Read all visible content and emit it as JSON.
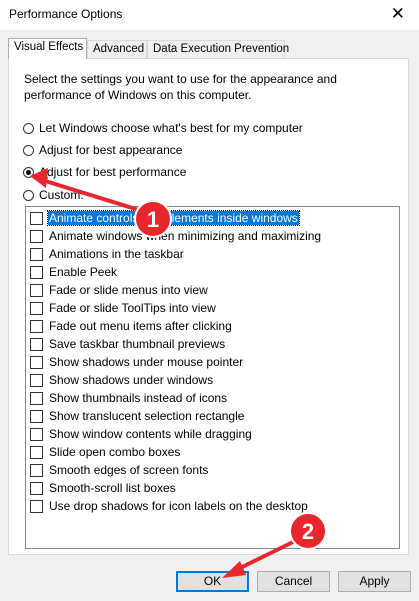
{
  "window": {
    "title": "Performance Options",
    "close_glyph": "✕"
  },
  "tabs": [
    {
      "label": "Visual Effects",
      "active": true
    },
    {
      "label": "Advanced",
      "active": false
    },
    {
      "label": "Data Execution Prevention",
      "active": false
    }
  ],
  "description": "Select the settings you want to use for the appearance and performance of Windows on this computer.",
  "radios": [
    {
      "label": "Let Windows choose what's best for my computer",
      "checked": false
    },
    {
      "label": "Adjust for best appearance",
      "checked": false
    },
    {
      "label": "Adjust for best performance",
      "checked": true
    },
    {
      "label": "Custom:",
      "checked": false
    }
  ],
  "effects": [
    {
      "label": "Animate controls and elements inside windows",
      "checked": false,
      "selected": true
    },
    {
      "label": "Animate windows when minimizing and maximizing",
      "checked": false
    },
    {
      "label": "Animations in the taskbar",
      "checked": false
    },
    {
      "label": "Enable Peek",
      "checked": false
    },
    {
      "label": "Fade or slide menus into view",
      "checked": false
    },
    {
      "label": "Fade or slide ToolTips into view",
      "checked": false
    },
    {
      "label": "Fade out menu items after clicking",
      "checked": false
    },
    {
      "label": "Save taskbar thumbnail previews",
      "checked": false
    },
    {
      "label": "Show shadows under mouse pointer",
      "checked": false
    },
    {
      "label": "Show shadows under windows",
      "checked": false
    },
    {
      "label": "Show thumbnails instead of icons",
      "checked": false
    },
    {
      "label": "Show translucent selection rectangle",
      "checked": false
    },
    {
      "label": "Show window contents while dragging",
      "checked": false
    },
    {
      "label": "Slide open combo boxes",
      "checked": false
    },
    {
      "label": "Smooth edges of screen fonts",
      "checked": false
    },
    {
      "label": "Smooth-scroll list boxes",
      "checked": false
    },
    {
      "label": "Use drop shadows for icon labels on the desktop",
      "checked": false
    }
  ],
  "buttons": {
    "ok": "OK",
    "cancel": "Cancel",
    "apply": "Apply"
  },
  "annotations": [
    {
      "number": "1",
      "color": "#e8262d"
    },
    {
      "number": "2",
      "color": "#e8262d"
    }
  ]
}
